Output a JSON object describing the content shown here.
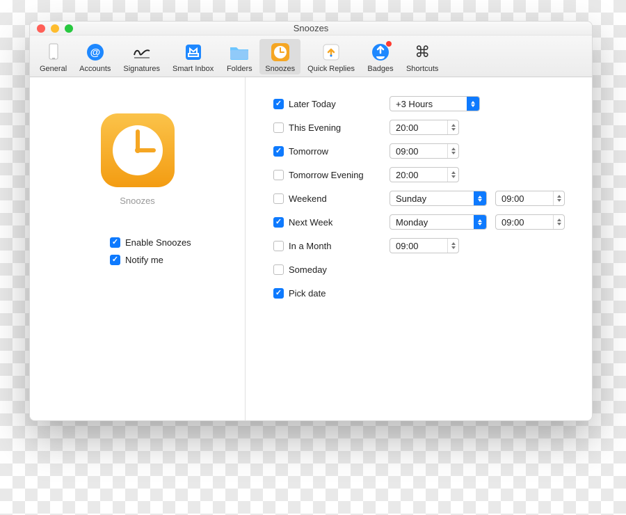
{
  "window": {
    "title": "Snoozes"
  },
  "toolbar": {
    "items": [
      {
        "label": "General"
      },
      {
        "label": "Accounts"
      },
      {
        "label": "Signatures"
      },
      {
        "label": "Smart Inbox"
      },
      {
        "label": "Folders"
      },
      {
        "label": "Snoozes"
      },
      {
        "label": "Quick Replies"
      },
      {
        "label": "Badges"
      },
      {
        "label": "Shortcuts"
      }
    ]
  },
  "sidebar": {
    "caption": "Snoozes",
    "enable": {
      "label": "Enable Snoozes",
      "checked": true
    },
    "notify": {
      "label": "Notify me",
      "checked": true
    }
  },
  "options": {
    "later_today": {
      "label": "Later Today",
      "checked": true,
      "select": "+3 Hours"
    },
    "this_evening": {
      "label": "This Evening",
      "checked": false,
      "time": "20:00"
    },
    "tomorrow": {
      "label": "Tomorrow",
      "checked": true,
      "time": "09:00"
    },
    "tomorrow_evening": {
      "label": "Tomorrow Evening",
      "checked": false,
      "time": "20:00"
    },
    "weekend": {
      "label": "Weekend",
      "checked": false,
      "select": "Sunday",
      "time": "09:00"
    },
    "next_week": {
      "label": "Next Week",
      "checked": true,
      "select": "Monday",
      "time": "09:00"
    },
    "in_a_month": {
      "label": "In a Month",
      "checked": false,
      "time": "09:00"
    },
    "someday": {
      "label": "Someday",
      "checked": false
    },
    "pick_date": {
      "label": "Pick date",
      "checked": true
    }
  }
}
